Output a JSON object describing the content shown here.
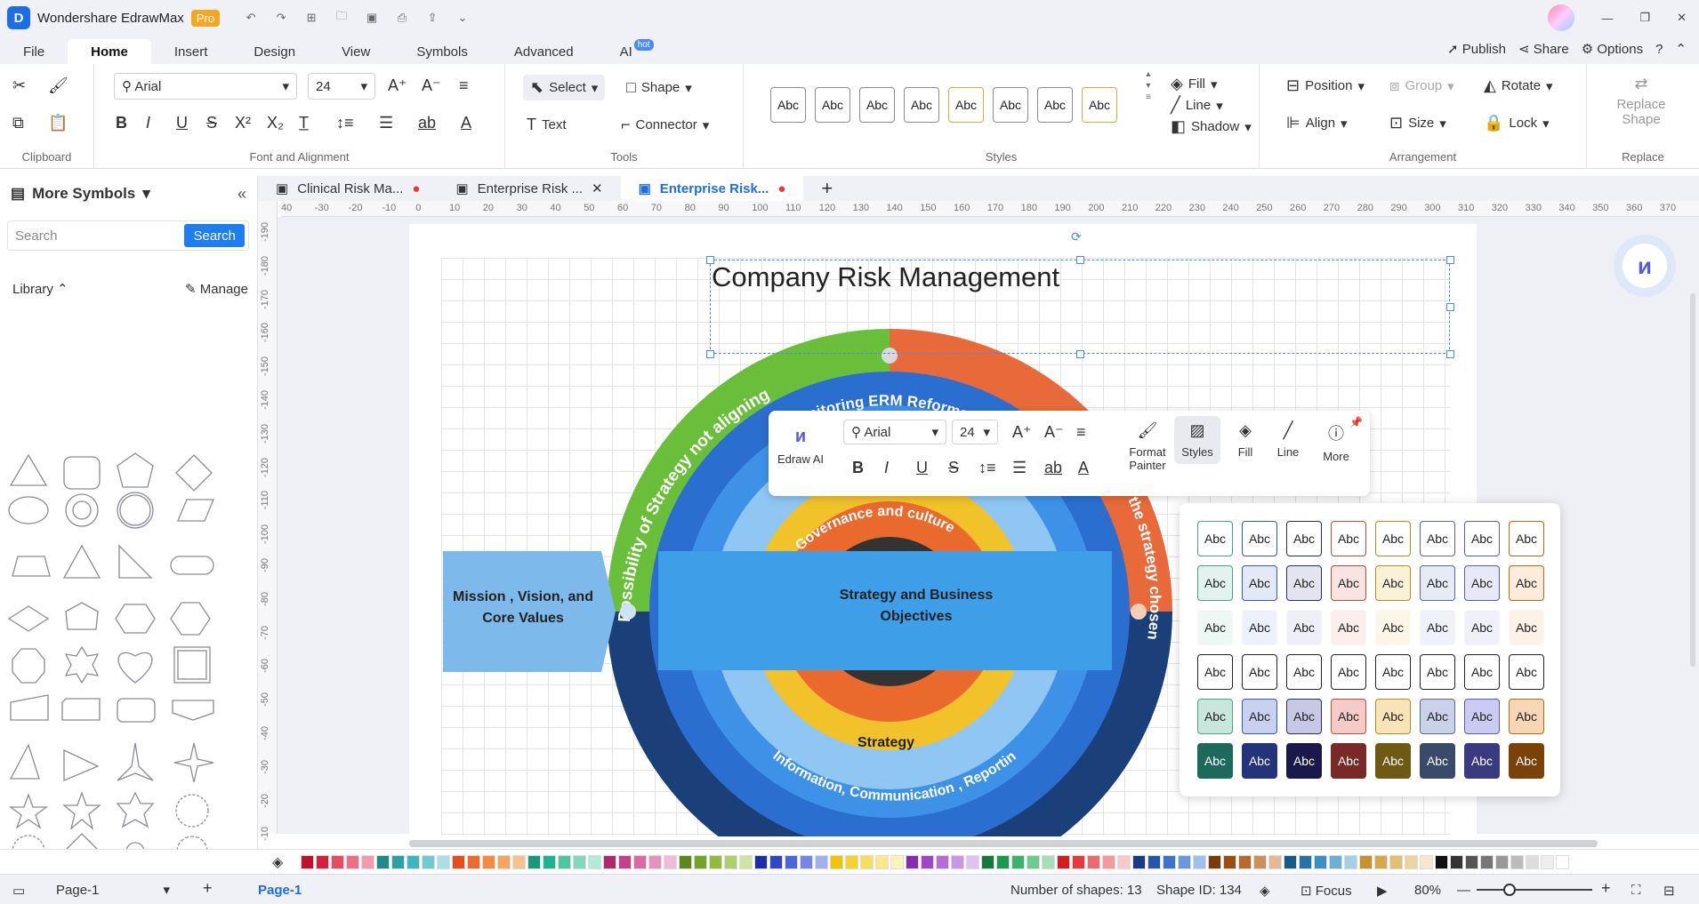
{
  "app": {
    "title": "Wondershare EdrawMax",
    "badge": "Pro"
  },
  "menu": {
    "tabs": [
      "File",
      "Home",
      "Insert",
      "Design",
      "View",
      "Symbols",
      "Advanced",
      "AI"
    ],
    "hot_badge": "hot",
    "right": {
      "publish": "Publish",
      "share": "Share",
      "options": "Options"
    }
  },
  "ribbon": {
    "clipboard_label": "Clipboard",
    "font_label": "Font and Alignment",
    "font_family": "Arial",
    "font_size": "24",
    "tools_label": "Tools",
    "select": "Select",
    "shape": "Shape",
    "text": "Text",
    "connector": "Connector",
    "styles_label": "Styles",
    "style_swatch": "Abc",
    "fill": "Fill",
    "line": "Line",
    "shadow": "Shadow",
    "arrangement_label": "Arrangement",
    "position": "Position",
    "group": "Group",
    "rotate": "Rotate",
    "align": "Align",
    "size": "Size",
    "lock": "Lock",
    "replace_shape": "Replace Shape",
    "replace_label": "Replace"
  },
  "panel": {
    "title": "More Symbols",
    "search_placeholder": "Search",
    "search_button": "Search",
    "library": "Library",
    "manage": "Manage"
  },
  "doc_tabs": [
    {
      "label": "Clinical Risk Ma...",
      "dot": true
    },
    {
      "label": "Enterprise Risk ...",
      "dot": false
    },
    {
      "label": "Enterprise Risk...",
      "dot": true
    }
  ],
  "rulers": {
    "h": [
      "40",
      "-30",
      "-20",
      "-10",
      "0",
      "10",
      "20",
      "30",
      "40",
      "50",
      "60",
      "70",
      "80",
      "90",
      "100",
      "110",
      "120",
      "130",
      "140",
      "150",
      "160",
      "170",
      "180",
      "190",
      "200",
      "210",
      "220",
      "230",
      "240",
      "250",
      "260",
      "270",
      "280",
      "290",
      "300",
      "310",
      "320",
      "330",
      "340",
      "350",
      "360",
      "370"
    ],
    "v": [
      "-190",
      "-180",
      "-170",
      "-160",
      "-150",
      "-140",
      "-130",
      "-120",
      "-110",
      "-100",
      "-90",
      "-80",
      "-70",
      "-60",
      "-50",
      "-40",
      "-30",
      "-20",
      "-10"
    ]
  },
  "diagram": {
    "title": "Company Risk Management",
    "green_arc": "Possibility of Strategy not aligning",
    "monitor_arc": "Monitoring ERM Reformance",
    "orange_arc": "the strategy chosen",
    "gov_arc": "Governance and culture",
    "strategy": "Strategy",
    "info_arc": "Information, Communication , Reporting",
    "mission": "Mission , Vision, and Core Values",
    "objectives": "Strategy and Business Objectives"
  },
  "float_toolbar": {
    "ai": "Edraw AI",
    "font": "Arial",
    "size": "24",
    "format_painter": "Format Painter",
    "styles": "Styles",
    "fill": "Fill",
    "line": "Line",
    "more": "More"
  },
  "styles_popup": {
    "label": "Abc",
    "rows": [
      {
        "border": [
          "#4aa08a",
          "#3a58b0",
          "#2a2a70",
          "#c04a40",
          "#b09020",
          "#5a6a90",
          "#5a5ab0",
          "#b06a10"
        ],
        "fill": [
          "#fff",
          "#fff",
          "#fff",
          "#fff",
          "#fff",
          "#fff",
          "#fff",
          "#fff"
        ],
        "text": "#222"
      },
      {
        "border": [
          "#4aa08a",
          "#3a58b0",
          "#2a2a70",
          "#c04a40",
          "#b09020",
          "#5a6a90",
          "#5a5ab0",
          "#b06a10"
        ],
        "fill": [
          "#e2f2ee",
          "#e4e9f7",
          "#e4e4f0",
          "#f8e4e2",
          "#fbf1d9",
          "#e6ebf5",
          "#e8e8f8",
          "#fcecdd"
        ],
        "text": "#222"
      },
      {
        "border": [
          "#f4faf8",
          "#f3f5fc",
          "#f4f4f9",
          "#fcf3f2",
          "#fdf8ee",
          "#f4f6fa",
          "#f4f4fc",
          "#fdf5ee"
        ],
        "fill": [
          "#eef7f4",
          "#eef1fb",
          "#efeff7",
          "#fbeeed",
          "#fcf6e8",
          "#eff2f8",
          "#f0f0fb",
          "#fdf2e8"
        ],
        "text": "#222"
      },
      {
        "border": [
          "#222",
          "#222",
          "#222",
          "#222",
          "#222",
          "#222",
          "#222",
          "#222"
        ],
        "fill": [
          "#fff",
          "#fff",
          "#fff",
          "#fff",
          "#fff",
          "#fff",
          "#fff",
          "#fff"
        ],
        "text": "#222"
      },
      {
        "border": [
          "#4aa08a",
          "#3a58b0",
          "#2a2a70",
          "#c04a40",
          "#b09020",
          "#5a6a90",
          "#5a5ab0",
          "#b06a10"
        ],
        "fill": [
          "#c8e6dc",
          "#c8d2f0",
          "#c8c8e4",
          "#f4cbc6",
          "#f8e4b8",
          "#c9d2e8",
          "#cbcbf2",
          "#f8d7b6"
        ],
        "text": "#222"
      },
      {
        "border": [
          "#1e6a5a",
          "#22347a",
          "#1a1a4a",
          "#7a2a26",
          "#6e5a14",
          "#3c4a6a",
          "#3a3a80",
          "#7a4208"
        ],
        "fill": [
          "#1e6a5a",
          "#22347a",
          "#1a1a4a",
          "#7a2a26",
          "#6e5a14",
          "#3c4a6a",
          "#3a3a80",
          "#7a4208"
        ],
        "text": "#fff"
      }
    ]
  },
  "palette": [
    "#c0102a",
    "#d81e3a",
    "#e84a5f",
    "#ee6f85",
    "#f49aac",
    "#1f8a8a",
    "#2aa1a6",
    "#3bb7bf",
    "#6fcbd2",
    "#a7e0e6",
    "#e84e1b",
    "#f06a2a",
    "#f58b3d",
    "#f7a55c",
    "#f9c28a",
    "#159a7a",
    "#1db58e",
    "#4bc7a1",
    "#80d8bd",
    "#b3e9d8",
    "#b0286a",
    "#c8408a",
    "#db67a5",
    "#e690bf",
    "#f1badb",
    "#5a8a1a",
    "#72a520",
    "#8fbd3a",
    "#acd16a",
    "#cde59e",
    "#1b2fa8",
    "#2d48c8",
    "#4a66dc",
    "#7388e6",
    "#a1b0ef",
    "#f5c400",
    "#f8d22a",
    "#fadd5a",
    "#fce88a",
    "#fdf2ba",
    "#8a2ab0",
    "#a344c8",
    "#b96bda",
    "#cd95e6",
    "#e2c0f0",
    "#137a3a",
    "#1a9a4a",
    "#3bb36a",
    "#6dca90",
    "#a3e0b8",
    "#d61c1c",
    "#e83a3a",
    "#ef6a6a",
    "#f59a9a",
    "#fac8c8",
    "#1a3a8a",
    "#2456b0",
    "#3a74cc",
    "#6a98dc",
    "#a0c0ec",
    "#7a3a0a",
    "#9a4e14",
    "#b86a2a",
    "#d08e5a",
    "#e6b896",
    "#1a5a8a",
    "#2474aa",
    "#3a90c4",
    "#6ab0d8",
    "#a2d0ea",
    "#c8922a",
    "#d8a84a",
    "#e4be72",
    "#eed39c",
    "#f6e8c8",
    "#111111",
    "#333333",
    "#555555",
    "#777777",
    "#999999",
    "#bbbbbb",
    "#dddddd",
    "#eeeeee",
    "#ffffff"
  ],
  "status": {
    "page_select": "Page-1",
    "page_tab": "Page-1",
    "shapes": "Number of shapes: 13",
    "shape_id": "Shape ID: 134",
    "focus": "Focus",
    "zoom": "80%"
  }
}
